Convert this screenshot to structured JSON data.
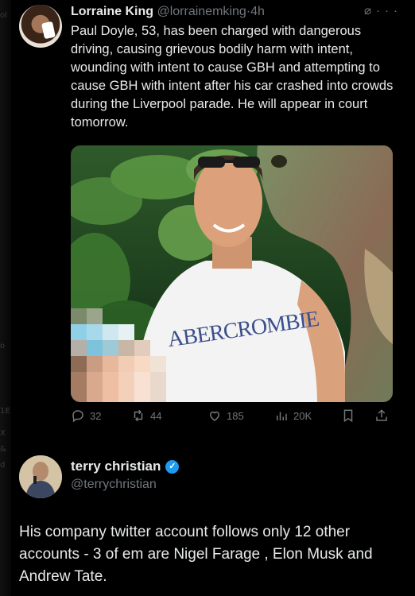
{
  "tweet1": {
    "author_name": "Lorraine King",
    "author_handle": "@lorrainemking",
    "separator": "·",
    "time": "4h",
    "text": "Paul Doyle, 53, has been charged with dangerous driving, causing grievous bodily harm with intent, wounding with intent to cause GBH and attempting to cause GBH with intent after his car crashed into crowds during the Liverpool parade. He will appear in court tomorrow.",
    "media": {
      "shirt_text": "ABERCROMBIE"
    },
    "stats": {
      "replies": "32",
      "reposts": "44",
      "likes": "185",
      "views": "20K"
    }
  },
  "tweet2": {
    "author_name": "terry christian",
    "author_handle": "@terrychristian",
    "verified": true,
    "text": "His company twitter account follows only 12 other accounts - 3 of em are Nigel Farage , Elon Musk and Andrew Tate."
  },
  "colors": {
    "background": "#000000",
    "text": "#e7e9ea",
    "muted": "#71767b",
    "verified": "#1d9bf0"
  },
  "icons": [
    "grok-icon",
    "more-icon",
    "reply-icon",
    "repost-icon",
    "like-icon",
    "views-icon",
    "bookmark-icon",
    "share-icon",
    "verified-badge-icon"
  ]
}
